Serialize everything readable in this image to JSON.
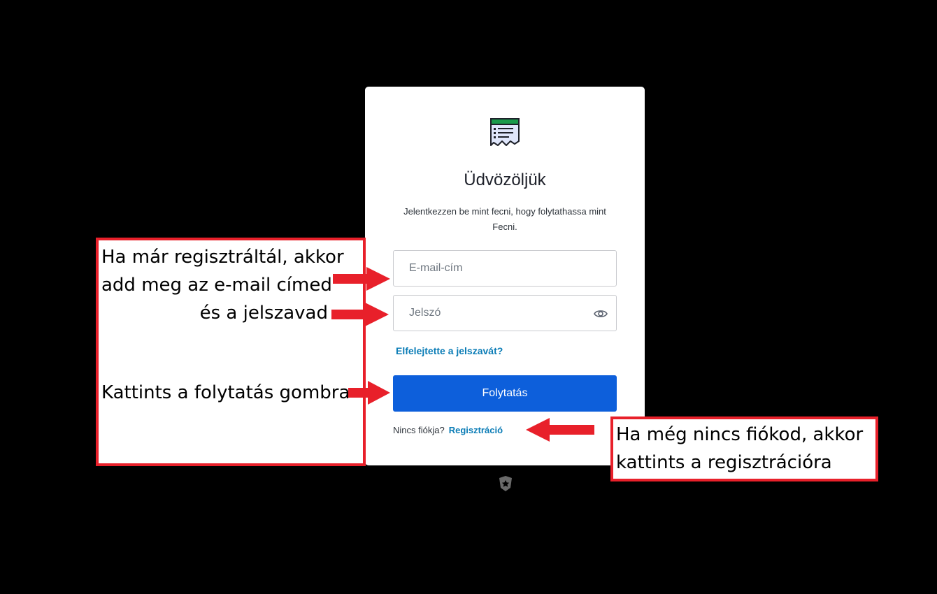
{
  "login": {
    "title": "Üdvözöljük",
    "subtitle": "Jelentkezzen be mint fecni, hogy folytathassa mint Fecni.",
    "email_placeholder": "E-mail-cím",
    "password_placeholder": "Jelszó",
    "forgot_link": "Elfelejtette a jelszavát?",
    "continue_label": "Folytatás",
    "no_account_text": "Nincs fiókja?",
    "signup_link": "Regisztráció"
  },
  "annotations": {
    "left_lines": [
      "Ha már regisztráltál, akkor",
      "add meg az e-mail címed",
      "és a jelszavad",
      "Kattints a folytatás gombra"
    ],
    "right_lines": [
      "Ha még nincs fiókod, akkor",
      "kattints a regisztrációra"
    ]
  },
  "icons": {
    "logo": "receipt-list-icon",
    "password_toggle": "eye-icon",
    "footer_badge": "shield-star-icon",
    "annotation_arrows": "red-arrow-icon"
  },
  "colors": {
    "primary_button": "#0d5fdb",
    "link": "#0a7cb6",
    "annotation_border": "#e8202a",
    "logo_green": "#1a9b4b"
  }
}
